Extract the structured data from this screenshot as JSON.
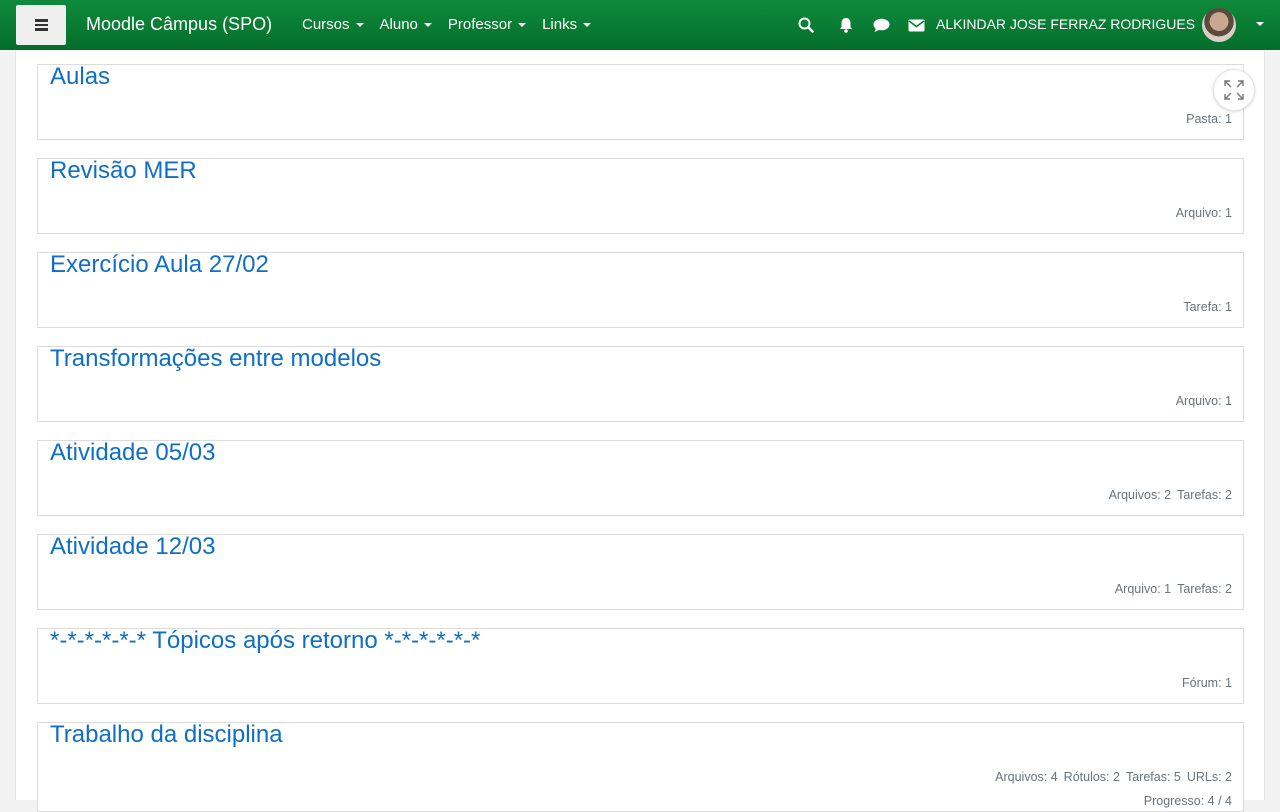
{
  "navbar": {
    "brand": "Moodle Câmpus (SPO)",
    "menus": [
      {
        "label": "Cursos"
      },
      {
        "label": "Aluno"
      },
      {
        "label": "Professor"
      },
      {
        "label": "Links"
      }
    ],
    "user_name": "ALKINDAR JOSE FERRAZ RODRIGUES",
    "icons": [
      "menu-icon",
      "search-icon",
      "bell-icon",
      "chat-icon",
      "envelope-icon",
      "expand-icon"
    ],
    "colors": {
      "navbar": "#087a32",
      "link": "#0f6fc5",
      "muted": "#6a737b"
    }
  },
  "sections": [
    {
      "title": "Aulas",
      "summary": [
        "Pasta: 1"
      ]
    },
    {
      "title": "Revisão MER",
      "summary": [
        "Arquivo: 1"
      ]
    },
    {
      "title": "Exercício Aula 27/02",
      "summary": [
        "Tarefa: 1"
      ]
    },
    {
      "title": "Transformações entre modelos",
      "summary": [
        "Arquivo: 1"
      ]
    },
    {
      "title": "Atividade 05/03",
      "summary": [
        "Arquivos: 2",
        "Tarefas: 2"
      ]
    },
    {
      "title": "Atividade 12/03",
      "summary": [
        "Arquivo: 1",
        "Tarefas: 2"
      ]
    },
    {
      "title": "*-*-*-*-*-* Tópicos após retorno *-*-*-*-*-*",
      "summary": [
        "Fórum: 1"
      ]
    },
    {
      "title": "Trabalho da disciplina",
      "summary": [
        "Arquivos: 4",
        "Rótulos: 2",
        "Tarefas: 5",
        "URLs: 2"
      ],
      "progress": "Progresso: 4 / 4"
    }
  ]
}
